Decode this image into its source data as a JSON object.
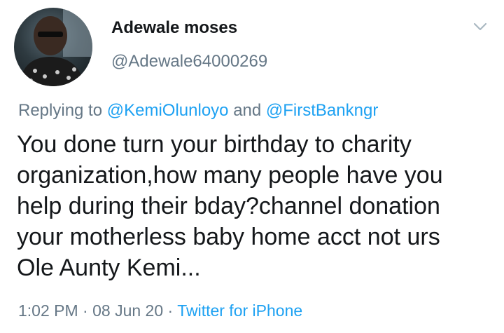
{
  "author": {
    "display_name": "Adewale moses",
    "handle": "@Adewale64000269"
  },
  "menu_icon": "chevron-down-icon",
  "reply_context": {
    "prefix": "Replying to",
    "mention_1": "@KemiOlunloyo",
    "conjunction": "and",
    "mention_2": "@FirstBankngr"
  },
  "tweet": {
    "lines": [
      "You done turn your birthday to charity",
      "organization,how many people have you",
      "help during their bday?channel donation",
      "your motherless baby home acct not urs",
      "Ole Aunty Kemi..."
    ]
  },
  "meta": {
    "time": "1:02 PM",
    "separator": "·",
    "date": "08 Jun 20",
    "source": "Twitter for iPhone"
  },
  "colors": {
    "link": "#1da1f2",
    "secondary_text": "#657786",
    "primary_text": "#14171a"
  }
}
